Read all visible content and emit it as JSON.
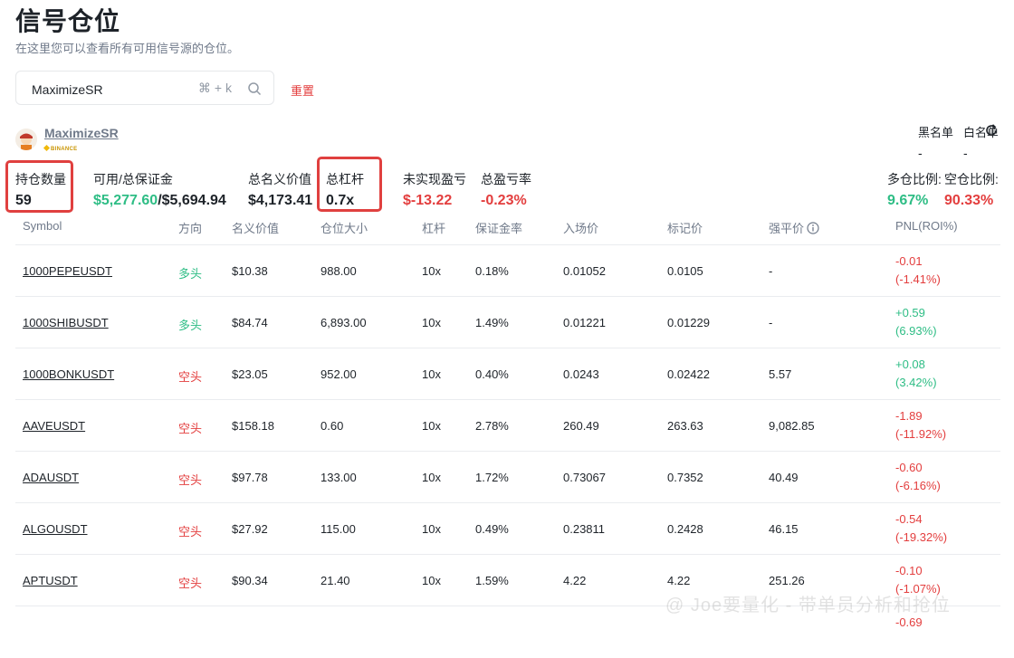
{
  "page": {
    "title": "信号仓位",
    "subtitle": "在这里您可以查看所有可用信号源的仓位。"
  },
  "search": {
    "value": "MaximizeSR",
    "shortcut": "⌘ + k",
    "reset_label": "重置"
  },
  "trader": {
    "name": "MaximizeSR",
    "exchange": "BINANCE"
  },
  "lists": {
    "blacklist_label": "黑名单",
    "blacklist_value": "-",
    "whitelist_label": "白名单",
    "whitelist_value": "-"
  },
  "stats": {
    "position_count_label": "持仓数量",
    "position_count": "59",
    "margin_label": "可用/总保证金",
    "margin_available": "$5,277.60",
    "margin_total": "/$5,694.94",
    "notional_label": "总名义价值",
    "notional": "$4,173.41",
    "leverage_label": "总杠杆",
    "leverage": "0.7x",
    "unrealized_label": "未实现盈亏",
    "unrealized": "$-13.22",
    "pnl_rate_label": "总盈亏率",
    "pnl_rate": "-0.23%",
    "long_ratio_label": "多仓比例:",
    "long_ratio": "9.67%",
    "short_ratio_label": "空仓比例:",
    "short_ratio": "90.33%"
  },
  "table": {
    "headers": [
      "Symbol",
      "方向",
      "名义价值",
      "仓位大小",
      "杠杆",
      "保证金率",
      "入场价",
      "标记价",
      "强平价",
      "PNL(ROI%)"
    ],
    "rows": [
      {
        "symbol": "1000PEPEUSDT",
        "side": "多头",
        "notional": "$10.38",
        "size": "988.00",
        "lev": "10x",
        "margin": "0.18%",
        "entry": "0.01052",
        "mark": "0.0105",
        "liq": "-",
        "pnl": "-0.01",
        "roi": "(-1.41%)"
      },
      {
        "symbol": "1000SHIBUSDT",
        "side": "多头",
        "notional": "$84.74",
        "size": "6,893.00",
        "lev": "10x",
        "margin": "1.49%",
        "entry": "0.01221",
        "mark": "0.01229",
        "liq": "-",
        "pnl": "+0.59",
        "roi": "(6.93%)"
      },
      {
        "symbol": "1000BONKUSDT",
        "side": "空头",
        "notional": "$23.05",
        "size": "952.00",
        "lev": "10x",
        "margin": "0.40%",
        "entry": "0.0243",
        "mark": "0.02422",
        "liq": "5.57",
        "pnl": "+0.08",
        "roi": "(3.42%)"
      },
      {
        "symbol": "AAVEUSDT",
        "side": "空头",
        "notional": "$158.18",
        "size": "0.60",
        "lev": "10x",
        "margin": "2.78%",
        "entry": "260.49",
        "mark": "263.63",
        "liq": "9,082.85",
        "pnl": "-1.89",
        "roi": "(-11.92%)"
      },
      {
        "symbol": "ADAUSDT",
        "side": "空头",
        "notional": "$97.78",
        "size": "133.00",
        "lev": "10x",
        "margin": "1.72%",
        "entry": "0.73067",
        "mark": "0.7352",
        "liq": "40.49",
        "pnl": "-0.60",
        "roi": "(-6.16%)"
      },
      {
        "symbol": "ALGOUSDT",
        "side": "空头",
        "notional": "$27.92",
        "size": "115.00",
        "lev": "10x",
        "margin": "0.49%",
        "entry": "0.23811",
        "mark": "0.2428",
        "liq": "46.15",
        "pnl": "-0.54",
        "roi": "(-19.32%)"
      },
      {
        "symbol": "APTUSDT",
        "side": "空头",
        "notional": "$90.34",
        "size": "21.40",
        "lev": "10x",
        "margin": "1.59%",
        "entry": "4.22",
        "mark": "4.22",
        "liq": "251.26",
        "pnl": "-0.10",
        "roi": "(-1.07%)"
      },
      {
        "symbol": "",
        "side": "",
        "notional": "",
        "size": "",
        "lev": "",
        "margin": "",
        "entry": "",
        "mark": "",
        "liq": "",
        "pnl": "-0.69",
        "roi": ""
      }
    ]
  },
  "watermark": "@ Joe要量化 - 带单员分析和抢位",
  "colors": {
    "positive": "#2ebd85",
    "negative": "#e33e3e",
    "highlight": "#e0403f"
  }
}
